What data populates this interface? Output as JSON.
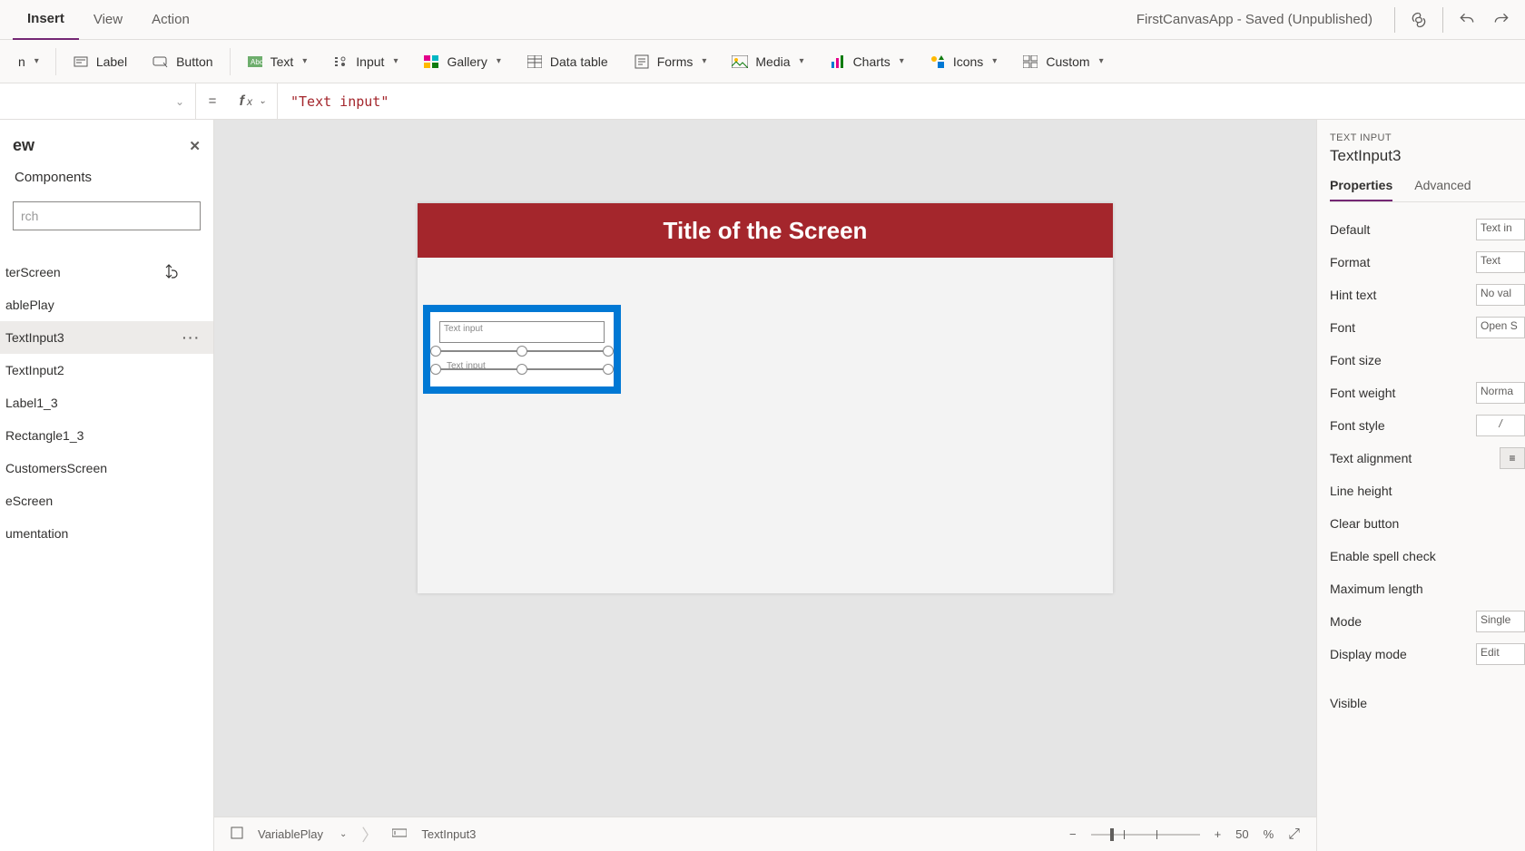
{
  "menu": {
    "insert": "Insert",
    "view": "View",
    "action": "Action"
  },
  "header": {
    "docTitle": "FirstCanvasApp - Saved (Unpublished)"
  },
  "ribbon": {
    "label": "Label",
    "button": "Button",
    "text": "Text",
    "input": "Input",
    "gallery": "Gallery",
    "dataTable": "Data table",
    "forms": "Forms",
    "media": "Media",
    "charts": "Charts",
    "icons": "Icons",
    "custom": "Custom"
  },
  "formula": {
    "value": "\"Text input\""
  },
  "tree": {
    "title": "ew",
    "componentsTab": "Components",
    "searchPlaceholder": "rch",
    "items": [
      "terScreen",
      "ablePlay",
      "TextInput3",
      "TextInput2",
      "Label1_3",
      "Rectangle1_3",
      "CustomersScreen",
      "eScreen",
      "umentation"
    ],
    "selectedIndex": 2
  },
  "canvas": {
    "screenTitle": "Title of the Screen",
    "textInput1": "Text input",
    "textInput2": "Text input"
  },
  "props": {
    "caption": "TEXT INPUT",
    "controlName": "TextInput3",
    "tabProperties": "Properties",
    "tabAdvanced": "Advanced",
    "rows": {
      "default": {
        "label": "Default",
        "value": "Text in"
      },
      "format": {
        "label": "Format",
        "value": "Text"
      },
      "hint": {
        "label": "Hint text",
        "value": "No val"
      },
      "font": {
        "label": "Font",
        "value": "Open S"
      },
      "fontSize": {
        "label": "Font size",
        "value": ""
      },
      "fontWeight": {
        "label": "Font weight",
        "value": "Norma"
      },
      "fontStyle": {
        "label": "Font style",
        "value": "/"
      },
      "textAlign": {
        "label": "Text alignment"
      },
      "lineHeight": {
        "label": "Line height"
      },
      "clearButton": {
        "label": "Clear button"
      },
      "spellCheck": {
        "label": "Enable spell check"
      },
      "maxLength": {
        "label": "Maximum length"
      },
      "mode": {
        "label": "Mode",
        "value": "Single"
      },
      "displayMode": {
        "label": "Display mode",
        "value": "Edit"
      },
      "visible": {
        "label": "Visible"
      }
    }
  },
  "status": {
    "crumbScreen": "VariablePlay",
    "crumbControl": "TextInput3",
    "zoomPct": "50",
    "pctSymbol": "%"
  }
}
